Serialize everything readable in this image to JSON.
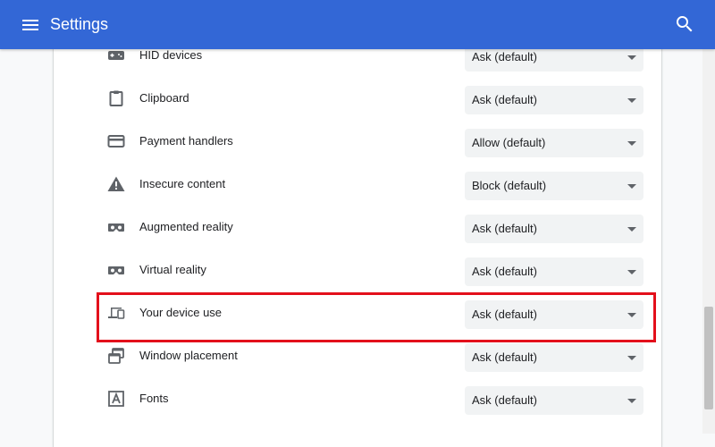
{
  "header": {
    "title": "Settings",
    "menu_icon": "hamburger-menu-icon",
    "search_icon": "search-icon",
    "background": "#3367d6"
  },
  "permissions": [
    {
      "icon": "hid-device-icon",
      "label": "HID devices",
      "value": "Ask (default)"
    },
    {
      "icon": "clipboard-icon",
      "label": "Clipboard",
      "value": "Ask (default)"
    },
    {
      "icon": "payment-card-icon",
      "label": "Payment handlers",
      "value": "Allow (default)"
    },
    {
      "icon": "warning-triangle-icon",
      "label": "Insecure content",
      "value": "Block (default)"
    },
    {
      "icon": "vr-headset-icon",
      "label": "Augmented reality",
      "value": "Ask (default)"
    },
    {
      "icon": "vr-headset-icon",
      "label": "Virtual reality",
      "value": "Ask (default)"
    },
    {
      "icon": "devices-icon",
      "label": "Your device use",
      "value": "Ask (default)"
    },
    {
      "icon": "window-placement-icon",
      "label": "Window placement",
      "value": "Ask (default)"
    },
    {
      "icon": "fonts-icon",
      "label": "Fonts",
      "value": "Ask (default)"
    }
  ],
  "highlight_color": "#e3101b"
}
